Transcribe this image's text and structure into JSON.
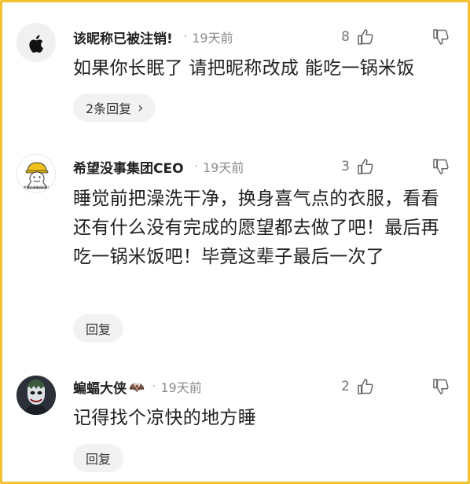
{
  "comments": [
    {
      "username": "该昵称已被注销!",
      "time": "19天前",
      "likes": "8",
      "text": "如果你长眠了 请把昵称改成 能吃一锅米饭",
      "reply_label": "2条回复",
      "avatar_icon": "apple-logo-icon"
    },
    {
      "username": "希望没事集团CEO",
      "time": "19天前",
      "likes": "3",
      "text": "睡觉前把澡洗干净，换身喜气点的衣服，看看还有什么没有完成的愿望都去做了吧！最后再吃一锅米饭吧！毕竟这辈子最后一次了",
      "reply_label": "回复",
      "avatar_caption": "希望没事集团CEO",
      "avatar_icon": "hardhat-worker-avatar"
    },
    {
      "username": "蝙蝠大侠",
      "username_badge": "🦇",
      "time": "19天前",
      "likes": "2",
      "text": "记得找个凉快的地方睡",
      "reply_label": "回复",
      "avatar_icon": "joker-avatar"
    }
  ],
  "separator": "·",
  "colors": {
    "frame_border": "#f2c233",
    "reply_bg": "#f2f2f2",
    "meta_gray": "#8a8a8a"
  }
}
